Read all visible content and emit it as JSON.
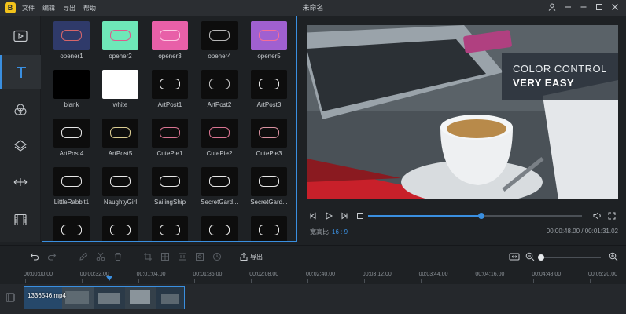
{
  "app": {
    "title": "未命名",
    "logo_glyph": "B",
    "menu": [
      "文件",
      "编辑",
      "导出",
      "帮助"
    ]
  },
  "sidebar": {
    "items": [
      {
        "name": "media",
        "icon": "video-file-icon"
      },
      {
        "name": "text",
        "icon": "text-icon",
        "active": true
      },
      {
        "name": "filters",
        "icon": "filter-circles-icon"
      },
      {
        "name": "overlays",
        "icon": "layers-icon"
      },
      {
        "name": "transitions",
        "icon": "transition-arrows-icon"
      },
      {
        "name": "elements",
        "icon": "film-strip-icon"
      }
    ]
  },
  "templates": [
    {
      "label": "opener1",
      "bg": "#2f3a6a",
      "accent": "#e86a6a"
    },
    {
      "label": "opener2",
      "bg": "#6ee8b8",
      "accent": "#e84a8a"
    },
    {
      "label": "opener3",
      "bg": "#e860a8",
      "accent": "#ffd1e8"
    },
    {
      "label": "opener4",
      "bg": "#0d0d0d",
      "accent": "#c9c9c9"
    },
    {
      "label": "opener5",
      "bg": "#a060d0",
      "accent": "#ff7090"
    },
    {
      "label": "blank",
      "bg": "#000000",
      "accent": "#000000"
    },
    {
      "label": "white",
      "bg": "#ffffff",
      "accent": "#ffffff"
    },
    {
      "label": "ArtPost1",
      "bg": "#0d0d0d",
      "accent": "#ffffff"
    },
    {
      "label": "ArtPost2",
      "bg": "#0d0d0d",
      "accent": "#d0d0d0"
    },
    {
      "label": "ArtPost3",
      "bg": "#0d0d0d",
      "accent": "#ffffff"
    },
    {
      "label": "ArtPost4",
      "bg": "#0d0d0d",
      "accent": "#ffffff"
    },
    {
      "label": "ArtPost5",
      "bg": "#0d0d0d",
      "accent": "#f0e0a0"
    },
    {
      "label": "CutePie1",
      "bg": "#0d0d0d",
      "accent": "#f080a0"
    },
    {
      "label": "CutePie2",
      "bg": "#0d0d0d",
      "accent": "#f080a0"
    },
    {
      "label": "CutePie3",
      "bg": "#0d0d0d",
      "accent": "#f0a0b0"
    },
    {
      "label": "LittleRabbit1",
      "bg": "#0d0d0d",
      "accent": "#ffffff"
    },
    {
      "label": "NaughtyGirl",
      "bg": "#0d0d0d",
      "accent": "#ffffff"
    },
    {
      "label": "SailingShip",
      "bg": "#0d0d0d",
      "accent": "#ffffff"
    },
    {
      "label": "SecretGard...",
      "bg": "#0d0d0d",
      "accent": "#ffffff"
    },
    {
      "label": "SecretGard...",
      "bg": "#0d0d0d",
      "accent": "#ffffff"
    },
    {
      "label": "",
      "bg": "#0d0d0d",
      "accent": "#ffffff"
    },
    {
      "label": "",
      "bg": "#0d0d0d",
      "accent": "#ffffff"
    },
    {
      "label": "",
      "bg": "#0d0d0d",
      "accent": "#ffffff"
    },
    {
      "label": "",
      "bg": "#0d0d0d",
      "accent": "#ffffff"
    },
    {
      "label": "",
      "bg": "#0d0d0d",
      "accent": "#ffffff"
    }
  ],
  "preview": {
    "overlay_line1": "COLOR CONTROL",
    "overlay_line2": "VERY EASY"
  },
  "playback": {
    "progress": 0.53,
    "ratio_label": "宽高比",
    "ratio_value": "16 : 9",
    "current_time": "00:00:48.00",
    "total_time": "00:01:31.02",
    "time_separator": " / "
  },
  "toolbar": {
    "export_label": "导出",
    "zoom_level": 0.0
  },
  "timeline": {
    "ticks": [
      "00:00:00.00",
      "00:00:32.00",
      "00:01:04.00",
      "00:01:36.00",
      "00:02:08.00",
      "00:02:40.00",
      "00:03:12.00",
      "00:03:44.00",
      "00:04:16.00",
      "00:04:48.00",
      "00:05:20.00"
    ],
    "clip_name": "1336546.mp4"
  },
  "colors": {
    "accent": "#3a8fe0",
    "background": "#1e2124",
    "panel": "#232629"
  }
}
